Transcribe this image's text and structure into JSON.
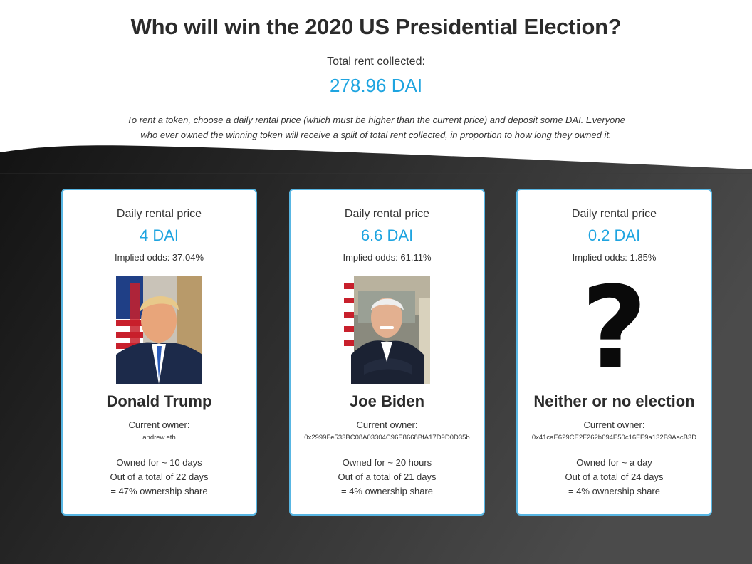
{
  "header": {
    "title": "Who will win the 2020 US Presidential Election?",
    "rent_label": "Total rent collected:",
    "rent_value": "278.96 DAI",
    "explanation": "To rent a token, choose a daily rental price (which must be higher than the current price) and deposit some DAI. Everyone who ever owned the winning token will receive a split of total rent collected, in proportion to how long they owned it."
  },
  "colors": {
    "accent": "#1ea4e0",
    "card_border": "#58b6e3",
    "dark_background_start": "#141414",
    "dark_background_end": "#4a4a4a"
  },
  "cards": [
    {
      "price_label": "Daily rental price",
      "price": "4 DAI",
      "odds": "Implied odds: 37.04%",
      "image": "donald-trump-portrait",
      "name": "Donald Trump",
      "owner_label": "Current owner:",
      "owner": "andrew.eth",
      "owned_for": "Owned for ~ 10 days",
      "total": "Out of a total of 22 days",
      "share": "= 47% ownership share"
    },
    {
      "price_label": "Daily rental price",
      "price": "6.6 DAI",
      "odds": "Implied odds: 61.11%",
      "image": "joe-biden-portrait",
      "name": "Joe Biden",
      "owner_label": "Current owner:",
      "owner": "0x2999Fe533BC08A03304C96E8668BfA17D9D0D35b",
      "owned_for": "Owned for ~ 20 hours",
      "total": "Out of a total of 21 days",
      "share": "= 4% ownership share"
    },
    {
      "price_label": "Daily rental price",
      "price": "0.2 DAI",
      "odds": "Implied odds: 1.85%",
      "image": "question-mark-icon",
      "symbol": "?",
      "name": "Neither or no election",
      "owner_label": "Current owner:",
      "owner": "0x41caE629CE2F262b694E50c16FE9a132B9AacB3D",
      "owned_for": "Owned for ~ a day",
      "total": "Out of a total of 24 days",
      "share": "= 4% ownership share"
    }
  ]
}
